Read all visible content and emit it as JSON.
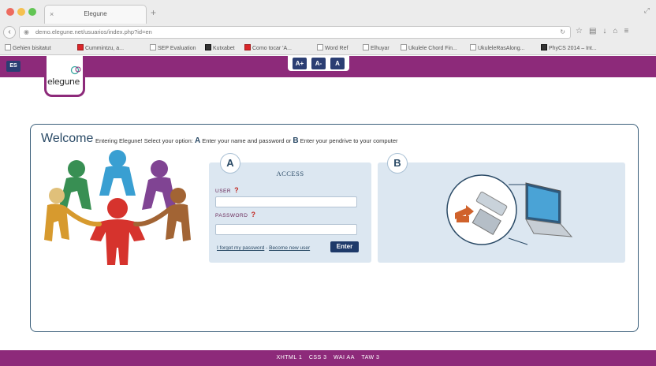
{
  "browser": {
    "tab_title": "Elegune",
    "url": "demo.elegune.net/usuarios/index.php?id=en",
    "bookmarks": [
      "Gehien bisitatut",
      "Cummintzu, a...",
      "SEP Evaluation",
      "Kutxabet",
      "Como tocar 'A...",
      "Word Ref",
      "Elhuyar",
      "Ukulele Chord Fin...",
      "UkuleleRasAlong...",
      "PhyCS 2014 – Int..."
    ]
  },
  "header": {
    "lang_button": "ES",
    "font_increase": "A+",
    "font_decrease": "A-",
    "font_contrast": "A"
  },
  "logo": {
    "text": "elegune"
  },
  "welcome": {
    "title": "Welcome",
    "intro": "Entering Elegune! Select your option:",
    "option_a_letter": "A",
    "option_a_text": "Enter your name and password or",
    "option_b_letter": "B",
    "option_b_text": "Enter your pendrive to your computer"
  },
  "login": {
    "badge": "A",
    "title": "ACCESS",
    "user_label": "USER",
    "password_label": "PASSWORD",
    "help_mark": "?",
    "forgot_link": "I forgot my password",
    "separator": " - ",
    "register_link": "Become new user",
    "enter_button": "Enter"
  },
  "usb": {
    "badge": "B"
  },
  "footer": {
    "items": [
      "XHTML 1",
      "CSS 3",
      "WAI AA",
      "TAW 3"
    ]
  }
}
